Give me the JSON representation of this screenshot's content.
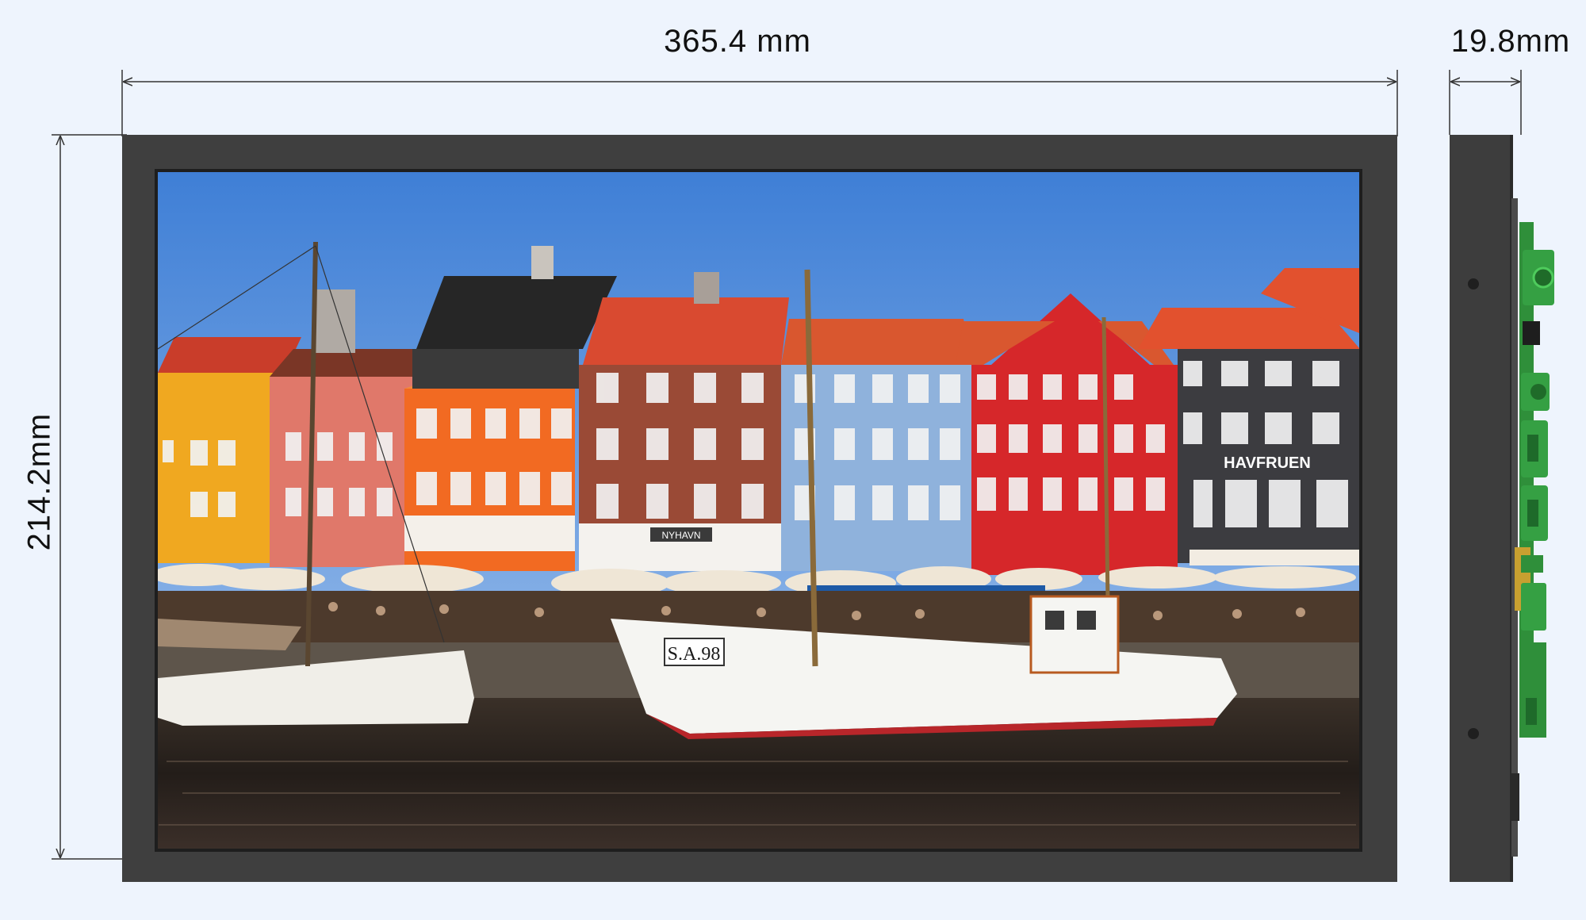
{
  "dimensions": {
    "width_label": "365.4 mm",
    "depth_label": "19.8mm",
    "height_label": "214.2mm"
  },
  "screen_image": {
    "sign_havfruen": "HAVFRUEN",
    "sign_nyhavn": "NYHAVN",
    "boat_registration": "S.A.98"
  },
  "colors": {
    "background": "#eef4fd",
    "bezel": "#3f3f3f",
    "pcb": "#2f8f3a",
    "dimension_line": "#333333"
  },
  "icons": [
    "arrow-left-icon",
    "arrow-right-icon",
    "arrow-up-icon",
    "arrow-down-icon",
    "connector-icon",
    "screw-icon"
  ]
}
